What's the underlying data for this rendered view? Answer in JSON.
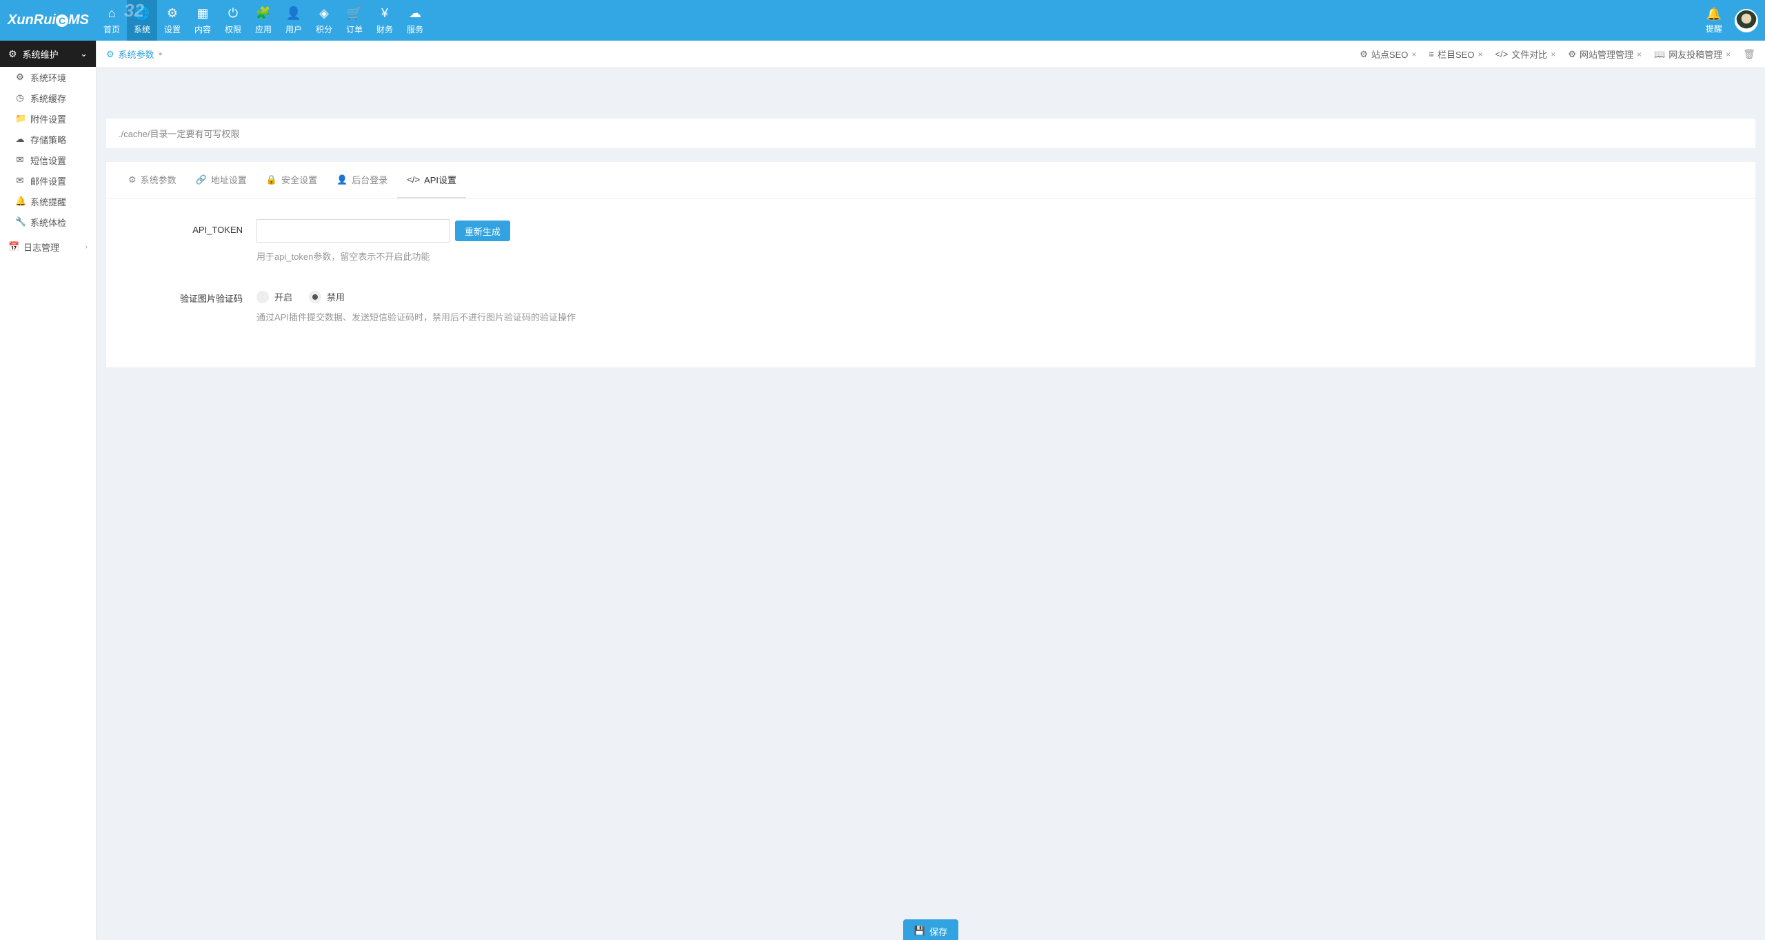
{
  "logo": "XunRuiCMS",
  "topBadge": "32",
  "topNav": [
    {
      "icon": "⌂",
      "label": "首页"
    },
    {
      "icon": "🌐",
      "label": "系统"
    },
    {
      "icon": "⚙",
      "label": "设置"
    },
    {
      "icon": "▦",
      "label": "内容"
    },
    {
      "icon": "⏻",
      "label": "权限"
    },
    {
      "icon": "🧩",
      "label": "应用"
    },
    {
      "icon": "👤",
      "label": "用户"
    },
    {
      "icon": "◈",
      "label": "积分"
    },
    {
      "icon": "🛒",
      "label": "订单"
    },
    {
      "icon": "¥",
      "label": "财务"
    },
    {
      "icon": "☁",
      "label": "服务"
    }
  ],
  "remind": "提醒",
  "sidebar": {
    "group": "系统维护",
    "items": [
      {
        "icon": "⚙",
        "label": "系统环境"
      },
      {
        "icon": "◷",
        "label": "系统缓存"
      },
      {
        "icon": "📁",
        "label": "附件设置"
      },
      {
        "icon": "☁",
        "label": "存储策略"
      },
      {
        "icon": "✉",
        "label": "短信设置"
      },
      {
        "icon": "✉",
        "label": "邮件设置"
      },
      {
        "icon": "🔔",
        "label": "系统提醒"
      },
      {
        "icon": "🔧",
        "label": "系统体检"
      }
    ],
    "log": {
      "icon": "📅",
      "label": "日志管理"
    }
  },
  "tabbar": {
    "current": "系统参数",
    "tabs": [
      {
        "icon": "⚙",
        "label": "站点SEO"
      },
      {
        "icon": "≡",
        "label": "栏目SEO"
      },
      {
        "icon": "</>",
        "label": "文件对比"
      },
      {
        "icon": "⚙",
        "label": "网站管理管理"
      },
      {
        "icon": "📖",
        "label": "网友投稿管理"
      }
    ]
  },
  "notice": "./cache/目录一定要有可写权限",
  "panelTabs": [
    {
      "icon": "⚙",
      "label": "系统参数"
    },
    {
      "icon": "🔗",
      "label": "地址设置"
    },
    {
      "icon": "🔒",
      "label": "安全设置"
    },
    {
      "icon": "👤",
      "label": "后台登录"
    },
    {
      "icon": "</>",
      "label": "API设置"
    }
  ],
  "form": {
    "apiToken": {
      "label": "API_TOKEN",
      "button": "重新生成",
      "help": "用于api_token参数，留空表示不开启此功能"
    },
    "captcha": {
      "label": "验证图片验证码",
      "on": "开启",
      "off": "禁用",
      "help": "通过API插件提交数据、发送短信验证码时，禁用后不进行图片验证码的验证操作"
    }
  },
  "save": "保存"
}
